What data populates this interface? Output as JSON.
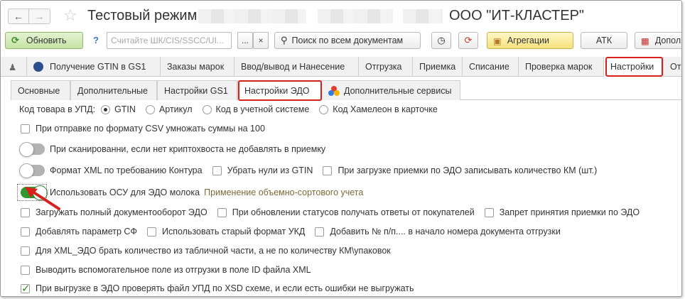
{
  "window": {
    "title": "Тестовый режим:",
    "org": "ООО \"ИТ-КЛАСТЕР\""
  },
  "toolbar": {
    "refresh_label": "Обновить",
    "help_label": "?",
    "search_placeholder": "Считайте ШК/CIS/SSCC/UI...",
    "more_label": "...",
    "clear_label": "×",
    "search_all_label": "Поиск по всем документам",
    "aggregation_label": "Агрегации",
    "atk_label": "АТК",
    "extra_label": "Допол"
  },
  "tabs": [
    {
      "label": "Получение GTIN в GS1"
    },
    {
      "label": "Заказы марок"
    },
    {
      "label": "Ввод/вывод и Нанесение"
    },
    {
      "label": "Отгрузка"
    },
    {
      "label": "Приемка"
    },
    {
      "label": "Списание"
    },
    {
      "label": "Проверка марок"
    },
    {
      "label": "Настройки"
    },
    {
      "label": "Отче"
    }
  ],
  "subtabs": [
    {
      "label": "Основные"
    },
    {
      "label": "Дополнительные"
    },
    {
      "label": "Настройки GS1"
    },
    {
      "label": "Настройки ЭДО"
    },
    {
      "label": "Дополнительные сервисы"
    }
  ],
  "settings": {
    "upd_code_label": "Код товара в УПД:",
    "upd_options": [
      "GTIN",
      "Артикул",
      "Код в учетной системе",
      "Код Хамелеон в карточке"
    ],
    "upd_selected": "GTIN",
    "csv_multiply": "При отправке по формату CSV умножать суммы на 100",
    "no_crypto_tail": "При сканированни, если нет криптохвоста не добавлять в приемку",
    "xml_kontur": "Формат XML по требованию Контура",
    "remove_zeros_gtin": "Убрать нули из GTIN",
    "load_km_count": "При загрузке приемки по ЭДО записывать количество КМ (шт.)",
    "use_osu_milk": "Использовать ОСУ для ЭДО молока",
    "osu_hint": "Применение объемно-сортового учета",
    "load_full_docflow": "Загружать полный документооборот ЭДО",
    "status_replies": "При обновлении статусов получать ответы от покупателей",
    "forbid_accept": "Запрет принятия приемки по ЭДО",
    "add_sf_param": "Добавлять параметр СФ",
    "old_ukd_format": "Использовать старый формат УКД",
    "add_line_number": "Добавить № п/п.... в начало номера документа отгрузки",
    "xml_edo_qty": "Для XML_ЭДО брать количество из табличной части, а не по количеству КМ\\упаковок",
    "aux_field": "Выводить вспомогательное поле из отгрузки в поле ID файла XML",
    "xsd_check": "При выгрузке в ЭДО проверять файл УПД по XSD схеме, и если есть ошибки не выгружать"
  },
  "state": {
    "toggle_no_crypto_tail": false,
    "toggle_xml_kontur": false,
    "toggle_use_osu_milk": true,
    "checked_xsd_check": true
  },
  "colors": {
    "highlight": "#d9211c",
    "toggle_on": "#2e9a2e",
    "refresh_bg": "#c6e3a5",
    "aggregation_bg": "#f5e27c"
  }
}
